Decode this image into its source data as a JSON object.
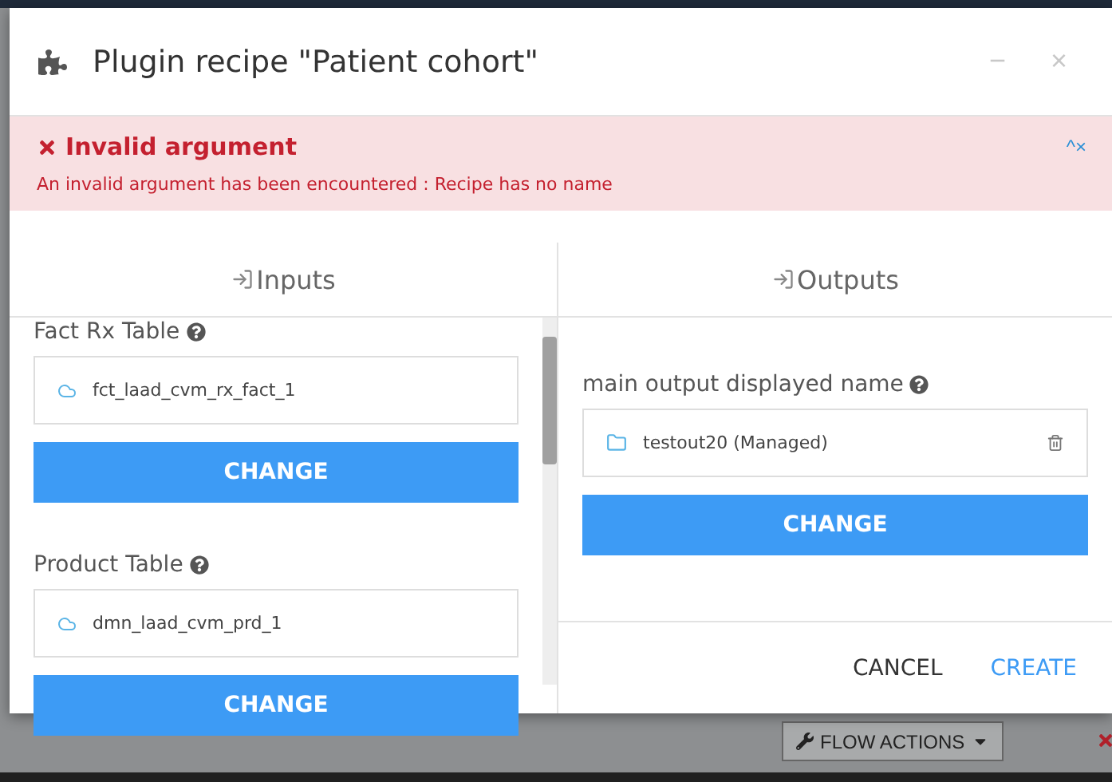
{
  "dialog": {
    "title": "Plugin recipe \"Patient cohort\"",
    "minimize": "−",
    "close": "×"
  },
  "error": {
    "title": "Invalid argument",
    "message": "An invalid argument has been encountered : Recipe has no name",
    "collapse": "^",
    "dismiss": "×"
  },
  "inputs": {
    "heading": "Inputs",
    "items": [
      {
        "label": "Fact Rx Table",
        "dataset": "fct_laad_cvm_rx_fact_1",
        "button": "CHANGE"
      },
      {
        "label": "Product Table",
        "dataset": "dmn_laad_cvm_prd_1",
        "button": "CHANGE"
      }
    ]
  },
  "outputs": {
    "heading": "Outputs",
    "items": [
      {
        "label": "main output displayed name",
        "dataset": "testout20 (Managed)",
        "button": "CHANGE"
      }
    ]
  },
  "footer": {
    "buttons": [
      {
        "label": "CANCEL",
        "kind": "secondary"
      },
      {
        "label": "CREATE",
        "kind": "primary"
      }
    ]
  },
  "background": {
    "flow_actions": "FLOW ACTIONS"
  }
}
